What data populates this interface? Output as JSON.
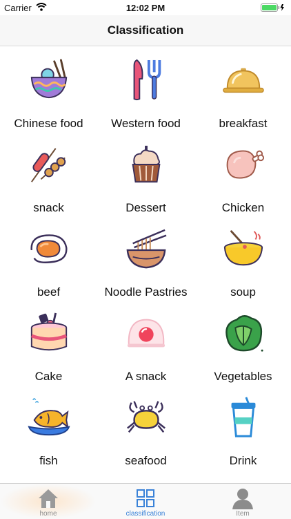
{
  "status": {
    "carrier": "Carrier",
    "time": "12:02 PM"
  },
  "nav": {
    "title": "Classification"
  },
  "categories": [
    {
      "label": "Chinese food",
      "icon": "rice-bowl-icon"
    },
    {
      "label": "Western food",
      "icon": "knife-fork-icon"
    },
    {
      "label": "breakfast",
      "icon": "cloche-icon"
    },
    {
      "label": "snack",
      "icon": "skewer-icon"
    },
    {
      "label": "Dessert",
      "icon": "cupcake-icon"
    },
    {
      "label": "Chicken",
      "icon": "chicken-leg-icon"
    },
    {
      "label": "beef",
      "icon": "steak-icon"
    },
    {
      "label": "Noodle Pastries",
      "icon": "noodle-bowl-icon"
    },
    {
      "label": "soup",
      "icon": "soup-bowl-icon"
    },
    {
      "label": "Cake",
      "icon": "cake-icon"
    },
    {
      "label": "A snack",
      "icon": "mochi-icon"
    },
    {
      "label": "Vegetables",
      "icon": "cabbage-icon"
    },
    {
      "label": "fish",
      "icon": "fish-plate-icon"
    },
    {
      "label": "seafood",
      "icon": "crab-icon"
    },
    {
      "label": "Drink",
      "icon": "drink-cup-icon"
    }
  ],
  "tabs": [
    {
      "label": "home",
      "icon": "home-icon",
      "active": false
    },
    {
      "label": "classification",
      "icon": "grid-icon",
      "active": true
    },
    {
      "label": "Item",
      "icon": "person-icon",
      "active": false
    }
  ],
  "colors": {
    "accent": "#3a82d8",
    "battery": "#4cd964"
  }
}
